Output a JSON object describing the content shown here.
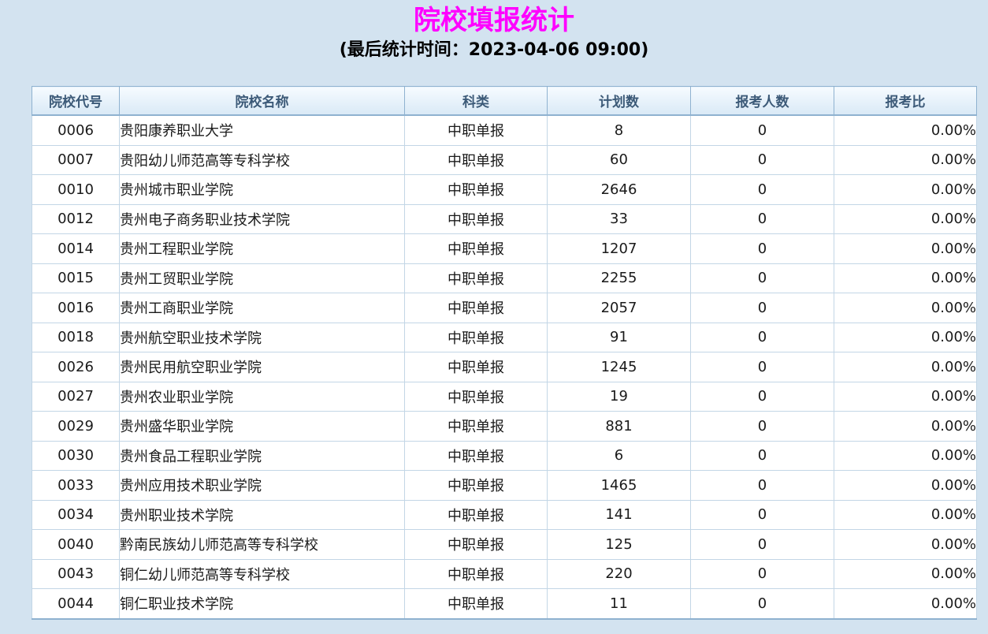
{
  "header": {
    "title": "院校填报统计",
    "subtitle": "(最后统计时间：2023-04-06 09:00)"
  },
  "table": {
    "columns": [
      "院校代号",
      "院校名称",
      "科类",
      "计划数",
      "报考人数",
      "报考比"
    ],
    "rows": [
      [
        "0006",
        "贵阳康养职业大学",
        "中职单报",
        "8",
        "0",
        "0.00%"
      ],
      [
        "0007",
        "贵阳幼儿师范高等专科学校",
        "中职单报",
        "60",
        "0",
        "0.00%"
      ],
      [
        "0010",
        "贵州城市职业学院",
        "中职单报",
        "2646",
        "0",
        "0.00%"
      ],
      [
        "0012",
        "贵州电子商务职业技术学院",
        "中职单报",
        "33",
        "0",
        "0.00%"
      ],
      [
        "0014",
        "贵州工程职业学院",
        "中职单报",
        "1207",
        "0",
        "0.00%"
      ],
      [
        "0015",
        "贵州工贸职业学院",
        "中职单报",
        "2255",
        "0",
        "0.00%"
      ],
      [
        "0016",
        "贵州工商职业学院",
        "中职单报",
        "2057",
        "0",
        "0.00%"
      ],
      [
        "0018",
        "贵州航空职业技术学院",
        "中职单报",
        "91",
        "0",
        "0.00%"
      ],
      [
        "0026",
        "贵州民用航空职业学院",
        "中职单报",
        "1245",
        "0",
        "0.00%"
      ],
      [
        "0027",
        "贵州农业职业学院",
        "中职单报",
        "19",
        "0",
        "0.00%"
      ],
      [
        "0029",
        "贵州盛华职业学院",
        "中职单报",
        "881",
        "0",
        "0.00%"
      ],
      [
        "0030",
        "贵州食品工程职业学院",
        "中职单报",
        "6",
        "0",
        "0.00%"
      ],
      [
        "0033",
        "贵州应用技术职业学院",
        "中职单报",
        "1465",
        "0",
        "0.00%"
      ],
      [
        "0034",
        "贵州职业技术学院",
        "中职单报",
        "141",
        "0",
        "0.00%"
      ],
      [
        "0040",
        "黔南民族幼儿师范高等专科学校",
        "中职单报",
        "125",
        "0",
        "0.00%"
      ],
      [
        "0043",
        "铜仁幼儿师范高等专科学校",
        "中职单报",
        "220",
        "0",
        "0.00%"
      ],
      [
        "0044",
        "铜仁职业技术学院",
        "中职单报",
        "11",
        "0",
        "0.00%"
      ]
    ]
  },
  "colors": {
    "title": "#ff00ff",
    "background": "#d3e3f0",
    "header_text": "#3c5a78",
    "border": "#8fb2d0"
  }
}
